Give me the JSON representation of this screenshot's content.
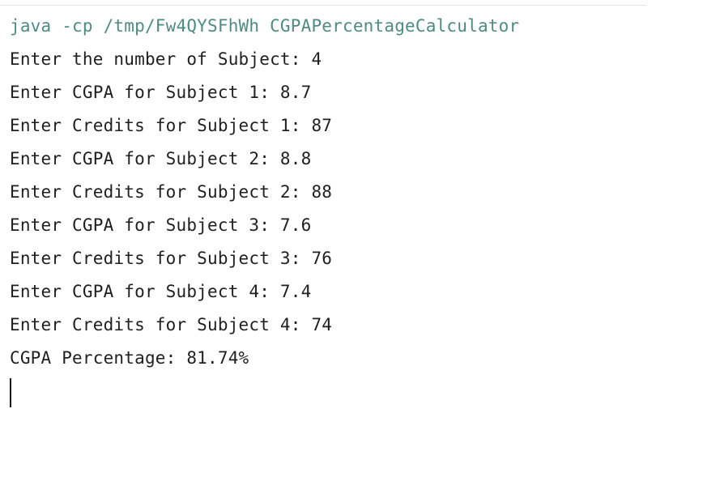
{
  "console": {
    "command": "java -cp /tmp/Fw4QYSFhWh CGPAPercentageCalculator",
    "output_lines": [
      "Enter the number of Subject: 4",
      "Enter CGPA for Subject 1: 8.7",
      "Enter Credits for Subject 1: 87",
      "Enter CGPA for Subject 2: 8.8",
      "Enter Credits for Subject 2: 88",
      "Enter CGPA for Subject 3: 7.6",
      "Enter Credits for Subject 3: 76",
      "Enter CGPA for Subject 4: 7.4",
      "Enter Credits for Subject 4: 74",
      "CGPA Percentage: 81.74%"
    ]
  },
  "colors": {
    "background": "#ffffff",
    "command_text": "#4f8a83",
    "output_text": "#1f1f1f"
  }
}
